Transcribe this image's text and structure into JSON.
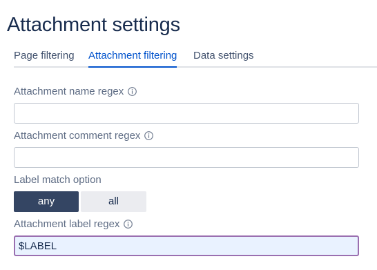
{
  "page": {
    "title": "Attachment settings"
  },
  "tabs": [
    {
      "label": "Page filtering",
      "active": false
    },
    {
      "label": "Attachment filtering",
      "active": true
    },
    {
      "label": "Data settings",
      "active": false
    }
  ],
  "fields": {
    "name_regex": {
      "label": "Attachment name regex",
      "value": ""
    },
    "comment_regex": {
      "label": "Attachment comment regex",
      "value": ""
    },
    "label_match": {
      "label": "Label match option",
      "options": [
        "any",
        "all"
      ],
      "selected": "any"
    },
    "label_regex": {
      "label": "Attachment label regex",
      "value": "$LABEL"
    }
  },
  "icons": {
    "info": "info-icon"
  },
  "colors": {
    "accent": "#0052cc",
    "selected_segment": "#344563",
    "focus_border": "#9a6fb0",
    "focus_background": "#e9f2ff"
  }
}
